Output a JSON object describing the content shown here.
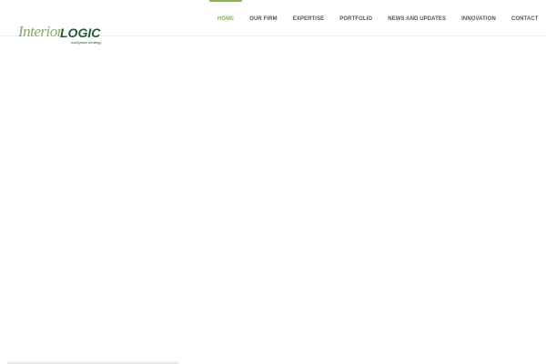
{
  "logo": {
    "word1": "Interior",
    "word2": "LOGIC",
    "tagline": "workplace strategy"
  },
  "nav": {
    "items": [
      {
        "label": "HOME",
        "active": true
      },
      {
        "label": "OUR FIRM"
      },
      {
        "label": "EXPERTISE"
      },
      {
        "label": "PORTFOLIO"
      },
      {
        "label": "NEWS AND UPDATES"
      },
      {
        "label": "INNOVATION"
      },
      {
        "label": "CONTACT"
      }
    ]
  },
  "colors": {
    "accent": "#8ab84a",
    "brand_dark": "#1f5a3c",
    "brand_light": "#8aa86a"
  }
}
